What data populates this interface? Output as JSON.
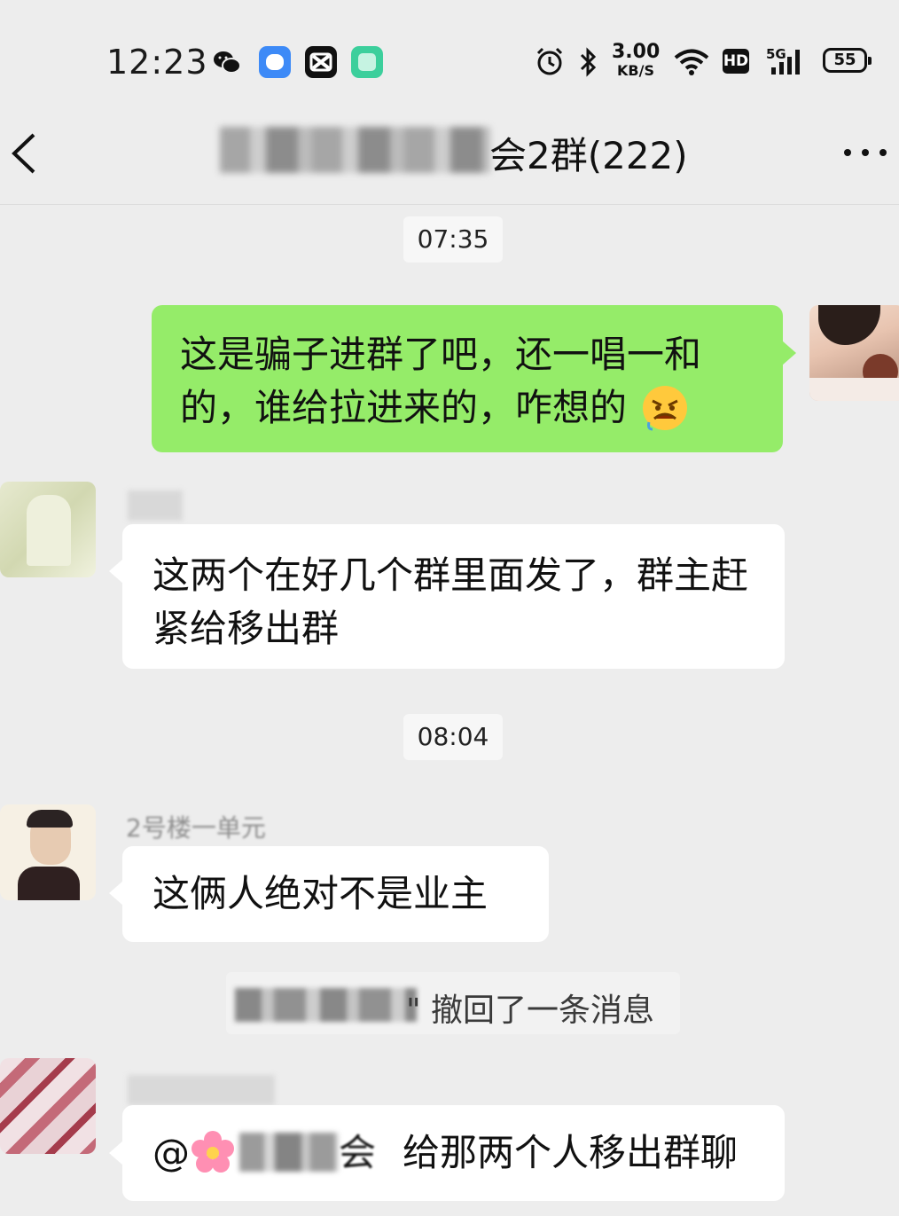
{
  "status_bar": {
    "time": "12:23",
    "net_speed_value": "3.00",
    "net_speed_unit": "KB/S",
    "hd_label": "HD",
    "signal_label": "5G",
    "battery": "55"
  },
  "header": {
    "title_visible": "会2群(222)"
  },
  "messages": {
    "time1": "07:35",
    "msg1_text": "这是骗子进群了吧，还一唱一和的，谁给拉进来的，咋想的",
    "msg2_text": "这两个在好几个群里面发了，群主赶紧给移出群",
    "time2": "08:04",
    "msg3_sender_visible": "2号楼一单元",
    "msg3_text": "这俩人绝对不是业主",
    "recall_text": "\" 撤回了一条消息",
    "msg4_at": "@",
    "msg4_tail": "会",
    "msg4_text": "给那两个人移出群聊"
  },
  "colors": {
    "background": "#ededed",
    "my_bubble": "#95ec69",
    "their_bubble": "#ffffff"
  },
  "icons": [
    "wechat-icon",
    "app-icon",
    "capcut-icon",
    "app-icon-green",
    "alarm-icon",
    "bluetooth-icon",
    "wifi-icon",
    "signal-icon",
    "back-icon",
    "more-icon",
    "angry-emoji-icon",
    "flower-emoji-icon"
  ]
}
